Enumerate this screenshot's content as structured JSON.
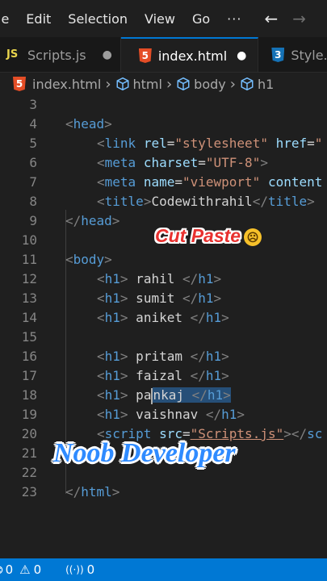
{
  "menu": {
    "items": [
      "le",
      "Edit",
      "Selection",
      "View",
      "Go"
    ],
    "more": "···",
    "back_arrow": "←",
    "forward_arrow": "→"
  },
  "tabs": [
    {
      "icon": "js-icon",
      "icon_text": "JS",
      "label": "Scripts.js",
      "modified": "●",
      "active": false
    },
    {
      "icon": "html5-icon",
      "icon_text": "5",
      "label": "index.html",
      "modified": "●",
      "active": true
    },
    {
      "icon": "css3-icon",
      "icon_text": "3",
      "label": "Style.css",
      "active": false
    }
  ],
  "breadcrumb": {
    "file": "index.html",
    "sep": "›",
    "items": [
      "html",
      "body",
      "h1"
    ]
  },
  "editor": {
    "lines": [
      {
        "n": "3"
      },
      {
        "n": "4",
        "tokens": [
          [
            "br",
            "<"
          ],
          [
            "tg",
            "head"
          ],
          [
            "br",
            ">"
          ]
        ],
        "indent": 0
      },
      {
        "n": "5",
        "tokens": [
          [
            "br",
            "<"
          ],
          [
            "tg",
            "link"
          ],
          [
            "tx",
            " "
          ],
          [
            "at",
            "rel"
          ],
          [
            "tx",
            "="
          ],
          [
            "st",
            "\"stylesheet\""
          ],
          [
            "tx",
            " "
          ],
          [
            "at",
            "href"
          ],
          [
            "tx",
            "="
          ],
          [
            "st",
            "\""
          ]
        ],
        "indent": 1
      },
      {
        "n": "6",
        "tokens": [
          [
            "br",
            "<"
          ],
          [
            "tg",
            "meta"
          ],
          [
            "tx",
            " "
          ],
          [
            "at",
            "charset"
          ],
          [
            "tx",
            "="
          ],
          [
            "st",
            "\"UTF-8\""
          ],
          [
            "br",
            ">"
          ]
        ],
        "indent": 1
      },
      {
        "n": "7",
        "tokens": [
          [
            "br",
            "<"
          ],
          [
            "tg",
            "meta"
          ],
          [
            "tx",
            " "
          ],
          [
            "at",
            "name"
          ],
          [
            "tx",
            "="
          ],
          [
            "st",
            "\"viewport\""
          ],
          [
            "tx",
            " "
          ],
          [
            "at",
            "content"
          ]
        ],
        "indent": 1
      },
      {
        "n": "8",
        "tokens": [
          [
            "br",
            "<"
          ],
          [
            "tg",
            "title"
          ],
          [
            "br",
            ">"
          ],
          [
            "tx",
            "Codewithrahil"
          ],
          [
            "br",
            "</"
          ],
          [
            "tg",
            "title"
          ],
          [
            "br",
            ">"
          ]
        ],
        "indent": 1
      },
      {
        "n": "9",
        "tokens": [
          [
            "br",
            "</"
          ],
          [
            "tg",
            "head"
          ],
          [
            "br",
            ">"
          ]
        ],
        "indent": 0
      },
      {
        "n": "10"
      },
      {
        "n": "11",
        "tokens": [
          [
            "br",
            "<"
          ],
          [
            "tg",
            "body"
          ],
          [
            "br",
            ">"
          ]
        ],
        "indent": 0
      },
      {
        "n": "12",
        "tokens": [
          [
            "br",
            "<"
          ],
          [
            "tg",
            "h1"
          ],
          [
            "br",
            ">"
          ],
          [
            "tx",
            " rahil "
          ],
          [
            "br",
            "</"
          ],
          [
            "tg",
            "h1"
          ],
          [
            "br",
            ">"
          ]
        ],
        "indent": 1
      },
      {
        "n": "13",
        "tokens": [
          [
            "br",
            "<"
          ],
          [
            "tg",
            "h1"
          ],
          [
            "br",
            ">"
          ],
          [
            "tx",
            " sumit "
          ],
          [
            "br",
            "</"
          ],
          [
            "tg",
            "h1"
          ],
          [
            "br",
            ">"
          ]
        ],
        "indent": 1
      },
      {
        "n": "14",
        "tokens": [
          [
            "br",
            "<"
          ],
          [
            "tg",
            "h1"
          ],
          [
            "br",
            ">"
          ],
          [
            "tx",
            " aniket "
          ],
          [
            "br",
            "</"
          ],
          [
            "tg",
            "h1"
          ],
          [
            "br",
            ">"
          ]
        ],
        "indent": 1
      },
      {
        "n": "15"
      },
      {
        "n": "16",
        "tokens": [
          [
            "br",
            "<"
          ],
          [
            "tg",
            "h1"
          ],
          [
            "br",
            ">"
          ],
          [
            "tx",
            " pritam "
          ],
          [
            "br",
            "</"
          ],
          [
            "tg",
            "h1"
          ],
          [
            "br",
            ">"
          ]
        ],
        "indent": 1
      },
      {
        "n": "17",
        "tokens": [
          [
            "br",
            "<"
          ],
          [
            "tg",
            "h1"
          ],
          [
            "br",
            ">"
          ],
          [
            "tx",
            " faizal "
          ],
          [
            "br",
            "</"
          ],
          [
            "tg",
            "h1"
          ],
          [
            "br",
            ">"
          ]
        ],
        "indent": 1
      },
      {
        "n": "18",
        "tokens": [
          [
            "br",
            "<"
          ],
          [
            "tg",
            "h1"
          ],
          [
            "br",
            ">"
          ],
          [
            "tx",
            " pa"
          ],
          [
            "cur",
            ""
          ],
          [
            "tx",
            "nkaj ",
            "sel"
          ],
          [
            "br",
            "</",
            "sel"
          ],
          [
            "tg",
            "h1",
            "sel"
          ],
          [
            "br",
            ">",
            "sel"
          ]
        ],
        "indent": 1
      },
      {
        "n": "19",
        "tokens": [
          [
            "br",
            "<"
          ],
          [
            "tg",
            "h1"
          ],
          [
            "br",
            ">"
          ],
          [
            "tx",
            " vaishnav "
          ],
          [
            "br",
            "</"
          ],
          [
            "tg",
            "h1"
          ],
          [
            "br",
            ">"
          ]
        ],
        "indent": 1
      },
      {
        "n": "20",
        "tokens": [
          [
            "br",
            "<"
          ],
          [
            "tg",
            "script"
          ],
          [
            "tx",
            " "
          ],
          [
            "at",
            "src"
          ],
          [
            "tx",
            "="
          ],
          [
            "st",
            "\"Scripts.js\"",
            "u"
          ],
          [
            "br",
            "></"
          ],
          [
            "tg",
            "sc"
          ]
        ],
        "indent": 1
      },
      {
        "n": "21"
      },
      {
        "n": "22"
      },
      {
        "n": "23",
        "tokens": [
          [
            "br",
            "</"
          ],
          [
            "tg",
            "html"
          ],
          [
            "br",
            ">"
          ]
        ],
        "indent": 0
      }
    ]
  },
  "overlays": {
    "cut_paste": "Cut Paste",
    "sad_emoji": "☹",
    "noob_developer": "Noob Developer"
  },
  "status": {
    "errors": "0",
    "warnings": "0",
    "ports": "0",
    "error_icon": "⊗",
    "warning_icon": "⚠",
    "ports_icon": "((·))"
  },
  "colors": {
    "accent": "#0078d4",
    "tag": "#569cd6",
    "attribute": "#9cdcfe",
    "string": "#ce9178",
    "selection": "#264f78"
  }
}
